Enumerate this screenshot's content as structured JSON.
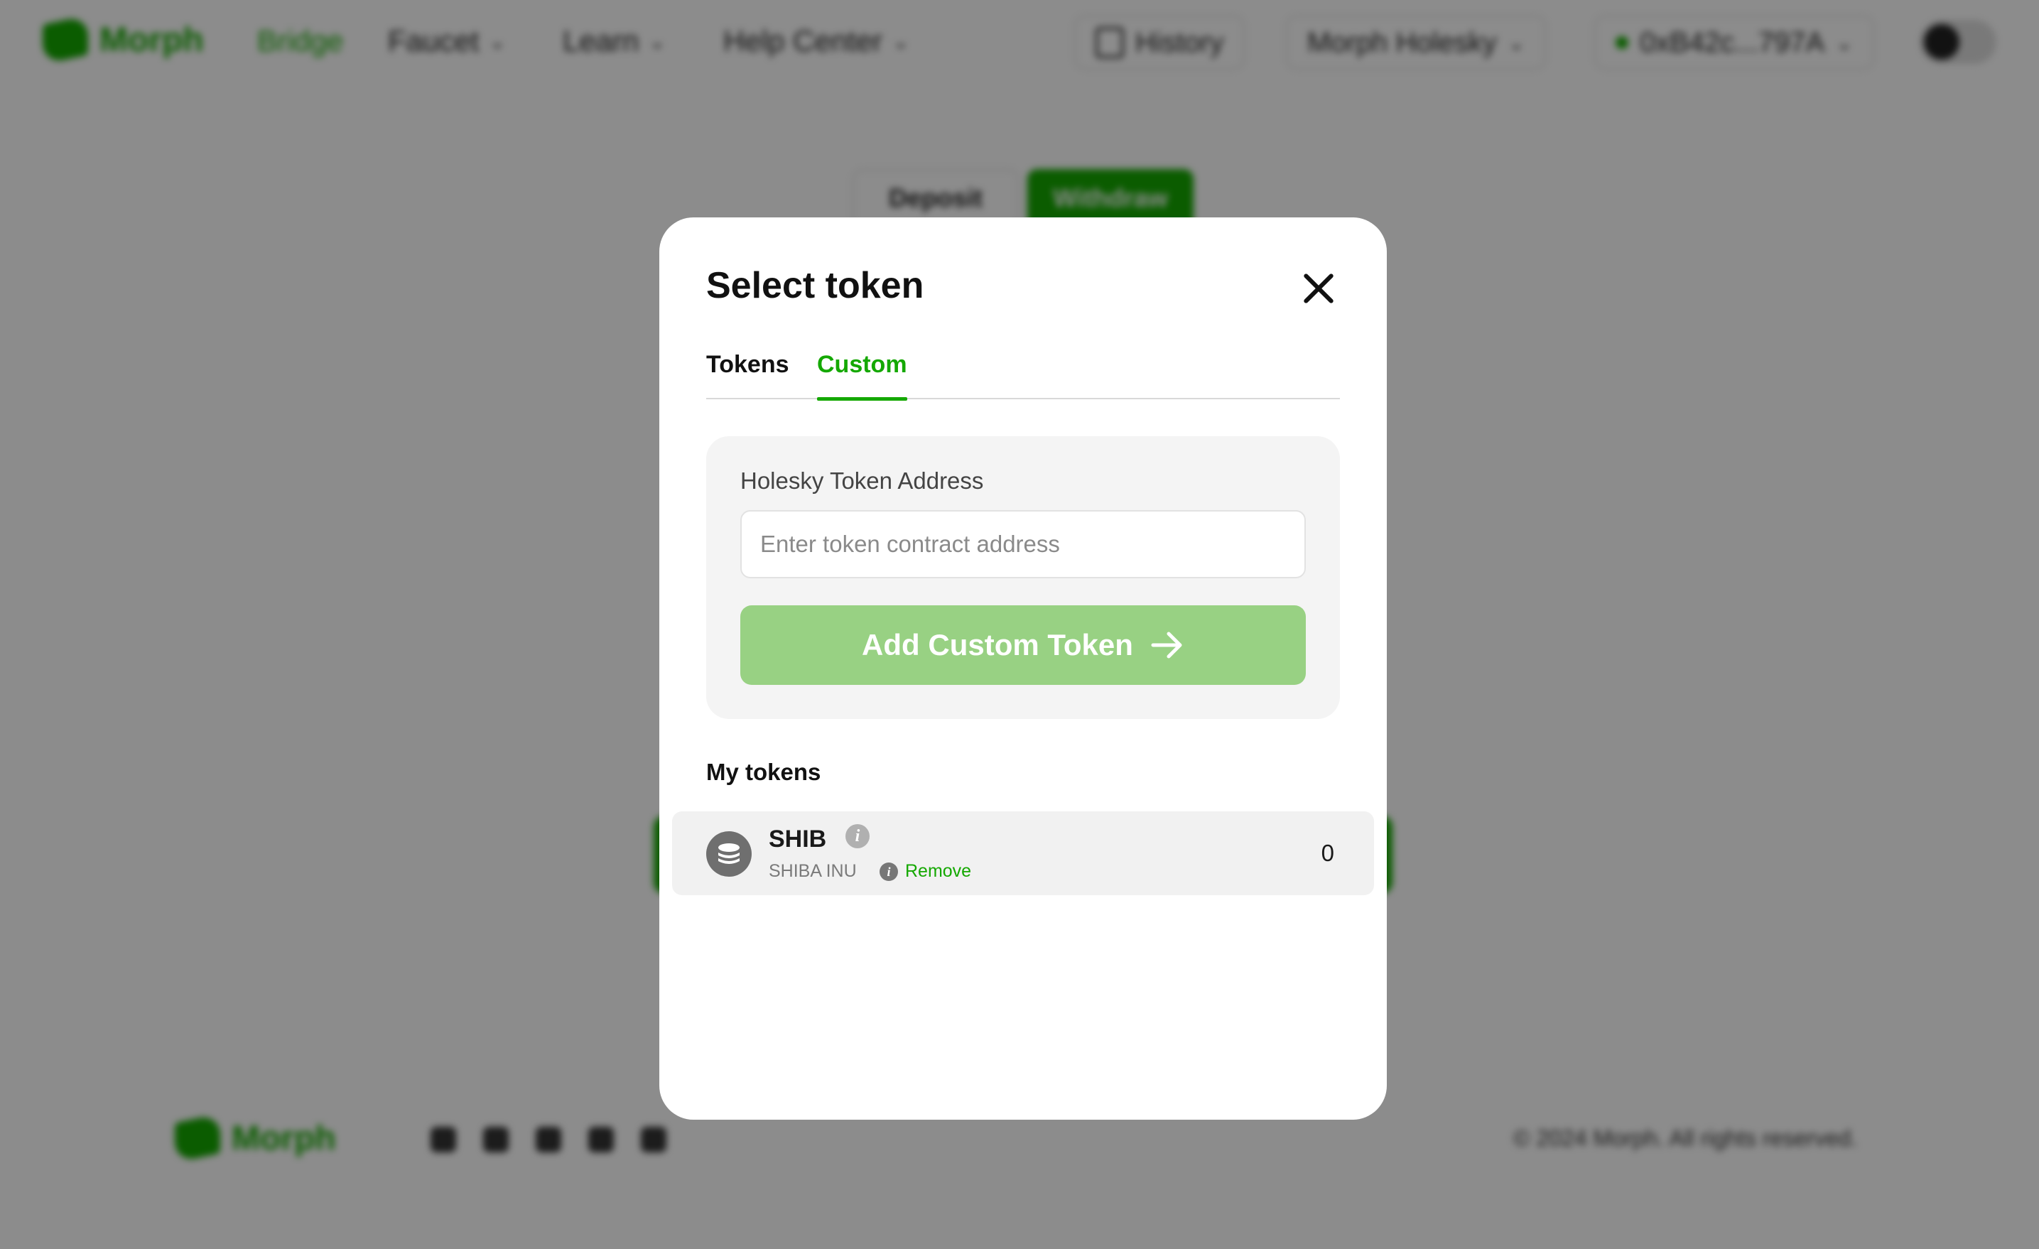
{
  "nav": {
    "logo": "Morph",
    "links": [
      {
        "label": "Bridge"
      },
      {
        "label": "Faucet"
      },
      {
        "label": "Learn"
      },
      {
        "label": "Help Center"
      }
    ],
    "history_label": "History",
    "network_label": "Morph Holesky",
    "wallet_label": "0xB42c...797A"
  },
  "background": {
    "tabs": [
      {
        "label": "Deposit"
      },
      {
        "label": "Withdraw"
      }
    ],
    "footer_logo": "Morph",
    "copyright": "© 2024 Morph. All rights reserved."
  },
  "modal": {
    "title": "Select token",
    "tabs": [
      {
        "label": "Tokens"
      },
      {
        "label": "Custom"
      }
    ],
    "active_tab": "Custom",
    "custom": {
      "field_label": "Holesky Token Address",
      "input_value": "",
      "input_placeholder": "Enter token contract address",
      "button_label": "Add Custom Token"
    },
    "my_tokens_title": "My tokens",
    "tokens": [
      {
        "symbol": "SHIB",
        "name": "SHIBA INU",
        "remove_label": "Remove",
        "balance": "0"
      }
    ]
  },
  "colors": {
    "accent": "#14a800",
    "button_disabled": "#98d183",
    "overlay": "rgba(0,0,0,0.45)"
  }
}
